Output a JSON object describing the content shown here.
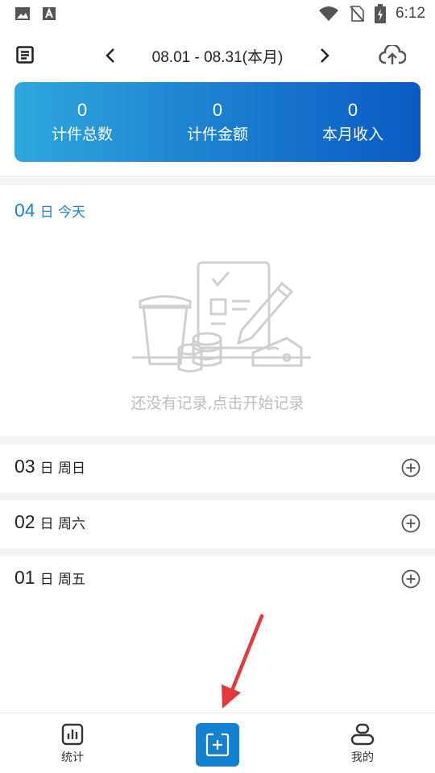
{
  "status_bar": {
    "time": "6:12",
    "icons": [
      "image-icon",
      "font-a-icon",
      "wifi-icon",
      "no-sim-icon",
      "battery-charging-icon"
    ]
  },
  "header": {
    "left_icon": "list-icon",
    "prev_icon": "chevron-left-icon",
    "date_range": "08.01 - 08.31(本月)",
    "next_icon": "chevron-right-icon",
    "right_icon": "cloud-upload-icon"
  },
  "summary": [
    {
      "value": "0",
      "label": "计件总数"
    },
    {
      "value": "0",
      "label": "计件金额"
    },
    {
      "value": "0",
      "label": "本月收入"
    }
  ],
  "today": {
    "day": "04",
    "suffix": "日 今天",
    "empty_text": "还没有记录,点击开始记录"
  },
  "days": [
    {
      "day": "03",
      "suffix": "日 周日"
    },
    {
      "day": "02",
      "suffix": "日 周六"
    },
    {
      "day": "01",
      "suffix": "日 周五"
    }
  ],
  "colors": {
    "accent": "#1a86cf",
    "card_start": "#2ea7dc",
    "card_end": "#0a5bc4",
    "empty_text": "#bdbdbd"
  },
  "bottom_nav": {
    "stats_label": "统计",
    "add_icon": "add-record-icon",
    "me_label": "我的"
  }
}
